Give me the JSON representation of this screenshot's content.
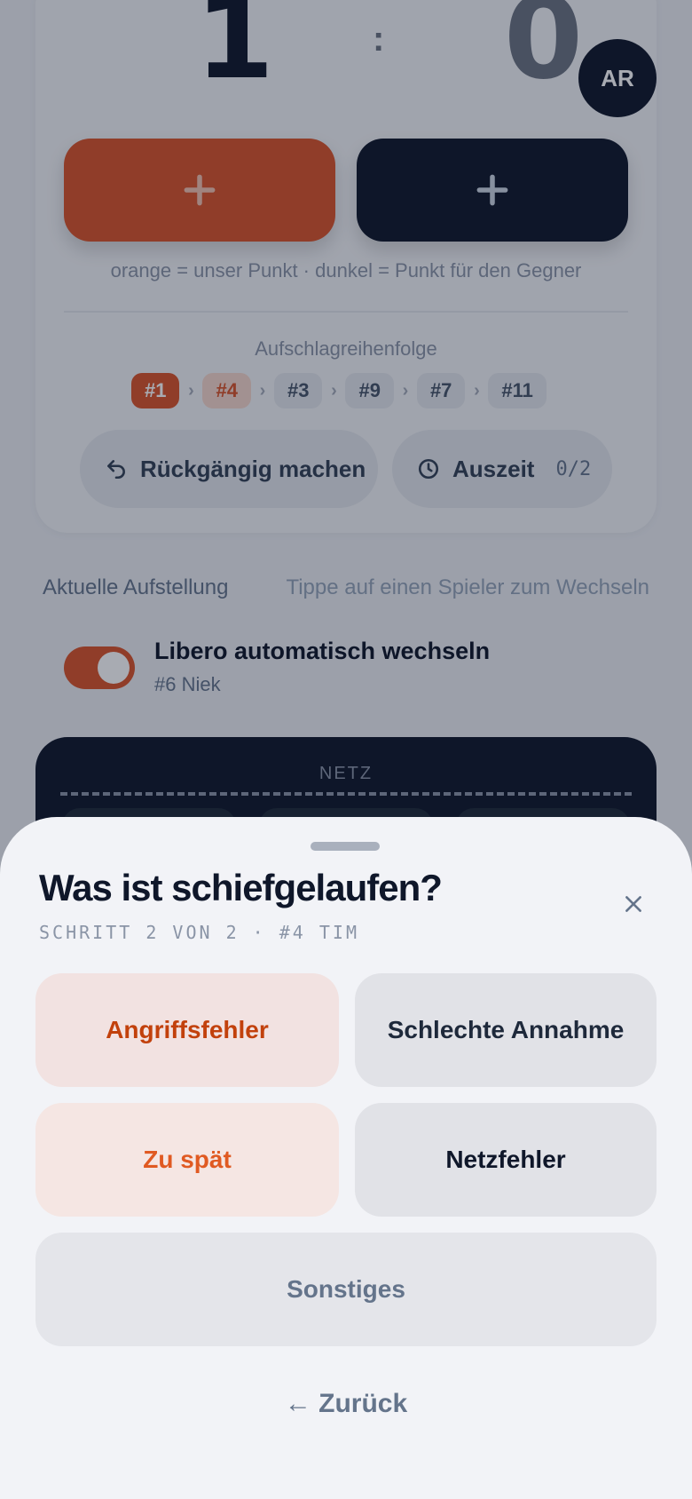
{
  "scoreboard": {
    "home_score": "1",
    "separator": ":",
    "away_score": "0",
    "avatar_initials": "AR",
    "legend": "orange = unser Punkt · dunkel = Punkt für den Gegner"
  },
  "serve_order": {
    "title": "Aufschlagreihenfolge",
    "players": [
      "#1",
      "#4",
      "#3",
      "#9",
      "#7",
      "#11"
    ]
  },
  "actions": {
    "undo_label": "Rückgängig machen",
    "timeout_label": "Auszeit",
    "timeout_count": "0/2"
  },
  "lineup": {
    "label": "Aktuelle Aufstellung",
    "hint": "Tippe auf einen Spieler zum Wechseln",
    "libero_toggle_label": "Libero automatisch wechseln",
    "libero_player": "#6 Niek",
    "libero_enabled": true
  },
  "court": {
    "net_label": "NETZ"
  },
  "sheet": {
    "title": "Was ist schiefgelaufen?",
    "step": "SCHRITT 2 VON 2 · #4 TIM",
    "options": [
      "Angriffsfehler",
      "Schlechte Annahme",
      "Zu spät",
      "Netzfehler",
      "Sonstiges"
    ],
    "back_label": "← Zurück"
  },
  "colors": {
    "accent": "#d9542a",
    "dark": "#0f172a"
  }
}
